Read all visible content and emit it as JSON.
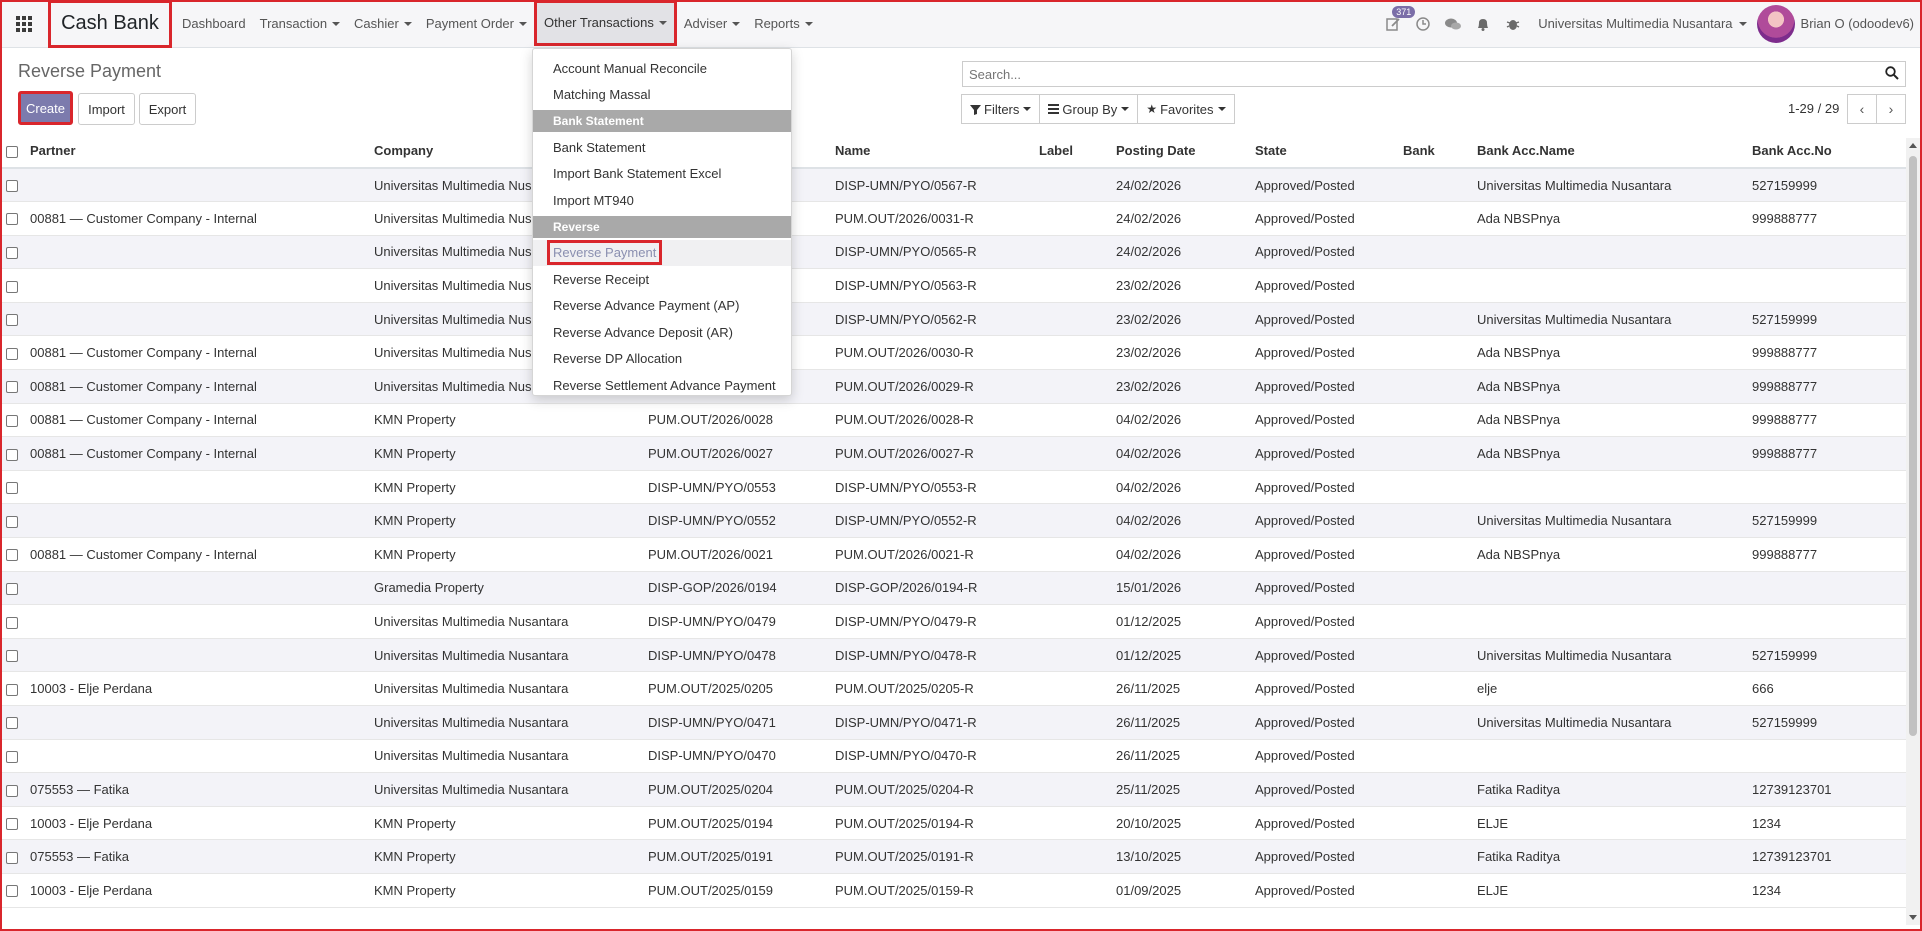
{
  "app": {
    "brand": "Cash Bank",
    "menu": [
      {
        "label": "Dashboard",
        "caret": false
      },
      {
        "label": "Transaction",
        "caret": true
      },
      {
        "label": "Cashier",
        "caret": true
      },
      {
        "label": "Payment Order",
        "caret": true
      },
      {
        "label": "Other Transactions",
        "caret": true,
        "open": true
      },
      {
        "label": "Adviser",
        "caret": true
      },
      {
        "label": "Reports",
        "caret": true
      }
    ],
    "activity_badge": "371",
    "company": "Universitas Multimedia Nusantara",
    "user": "Brian O (odoodev6)"
  },
  "control": {
    "breadcrumb": "Reverse Payment",
    "create": "Create",
    "import": "Import",
    "export": "Export",
    "search_placeholder": "Search...",
    "filters": "Filters",
    "group_by": "Group By",
    "favorites": "Favorites",
    "pager": "1-29 / 29"
  },
  "dropdown": {
    "items": [
      {
        "type": "item",
        "label": "Account Manual Reconcile"
      },
      {
        "type": "item",
        "label": "Matching Massal"
      },
      {
        "type": "header",
        "label": "Bank Statement"
      },
      {
        "type": "item",
        "label": "Bank Statement"
      },
      {
        "type": "item",
        "label": "Import Bank Statement Excel"
      },
      {
        "type": "item",
        "label": "Import MT940"
      },
      {
        "type": "header",
        "label": "Reverse"
      },
      {
        "type": "item",
        "label": "Reverse Payment",
        "active": true
      },
      {
        "type": "item",
        "label": "Reverse Receipt"
      },
      {
        "type": "item",
        "label": "Reverse Advance Payment (AP)"
      },
      {
        "type": "item",
        "label": "Reverse Advance Deposit (AR)"
      },
      {
        "type": "item",
        "label": "Reverse DP Allocation"
      },
      {
        "type": "item",
        "label": "Reverse Settlement Advance Payment"
      }
    ]
  },
  "table": {
    "columns": [
      "Partner",
      "Company",
      "",
      "Name",
      "Label",
      "Posting Date",
      "State",
      "Bank",
      "Bank Acc.Name",
      "Bank Acc.No"
    ],
    "rows": [
      [
        "",
        "Universitas Multimedia Nusantara",
        "",
        "DISP-UMN/PYO/0567-R",
        "",
        "24/02/2026",
        "Approved/Posted",
        "",
        "Universitas Multimedia Nusantara",
        "527159999"
      ],
      [
        "00881 — Customer Company - Internal",
        "Universitas Multimedia Nusantara",
        "",
        "PUM.OUT/2026/0031-R",
        "",
        "24/02/2026",
        "Approved/Posted",
        "",
        "Ada NBSPnya",
        "999888777"
      ],
      [
        "",
        "Universitas Multimedia Nusantara",
        "",
        "DISP-UMN/PYO/0565-R",
        "",
        "24/02/2026",
        "Approved/Posted",
        "",
        "",
        ""
      ],
      [
        "",
        "Universitas Multimedia Nusantara",
        "",
        "DISP-UMN/PYO/0563-R",
        "",
        "23/02/2026",
        "Approved/Posted",
        "",
        "",
        ""
      ],
      [
        "",
        "Universitas Multimedia Nusantara",
        "",
        "DISP-UMN/PYO/0562-R",
        "",
        "23/02/2026",
        "Approved/Posted",
        "",
        "Universitas Multimedia Nusantara",
        "527159999"
      ],
      [
        "00881 — Customer Company - Internal",
        "Universitas Multimedia Nusantara",
        "",
        "PUM.OUT/2026/0030-R",
        "",
        "23/02/2026",
        "Approved/Posted",
        "",
        "Ada NBSPnya",
        "999888777"
      ],
      [
        "00881 — Customer Company - Internal",
        "Universitas Multimedia Nusantara",
        "",
        "PUM.OUT/2026/0029-R",
        "",
        "23/02/2026",
        "Approved/Posted",
        "",
        "Ada NBSPnya",
        "999888777"
      ],
      [
        "00881 — Customer Company - Internal",
        "KMN Property",
        "PUM.OUT/2026/0028",
        "PUM.OUT/2026/0028-R",
        "",
        "04/02/2026",
        "Approved/Posted",
        "",
        "Ada NBSPnya",
        "999888777"
      ],
      [
        "00881 — Customer Company - Internal",
        "KMN Property",
        "PUM.OUT/2026/0027",
        "PUM.OUT/2026/0027-R",
        "",
        "04/02/2026",
        "Approved/Posted",
        "",
        "Ada NBSPnya",
        "999888777"
      ],
      [
        "",
        "KMN Property",
        "DISP-UMN/PYO/0553",
        "DISP-UMN/PYO/0553-R",
        "",
        "04/02/2026",
        "Approved/Posted",
        "",
        "",
        ""
      ],
      [
        "",
        "KMN Property",
        "DISP-UMN/PYO/0552",
        "DISP-UMN/PYO/0552-R",
        "",
        "04/02/2026",
        "Approved/Posted",
        "",
        "Universitas Multimedia Nusantara",
        "527159999"
      ],
      [
        "00881 — Customer Company - Internal",
        "KMN Property",
        "PUM.OUT/2026/0021",
        "PUM.OUT/2026/0021-R",
        "",
        "04/02/2026",
        "Approved/Posted",
        "",
        "Ada NBSPnya",
        "999888777"
      ],
      [
        "",
        "Gramedia Property",
        "DISP-GOP/2026/0194",
        "DISP-GOP/2026/0194-R",
        "",
        "15/01/2026",
        "Approved/Posted",
        "",
        "",
        ""
      ],
      [
        "",
        "Universitas Multimedia Nusantara",
        "DISP-UMN/PYO/0479",
        "DISP-UMN/PYO/0479-R",
        "",
        "01/12/2025",
        "Approved/Posted",
        "",
        "",
        ""
      ],
      [
        "",
        "Universitas Multimedia Nusantara",
        "DISP-UMN/PYO/0478",
        "DISP-UMN/PYO/0478-R",
        "",
        "01/12/2025",
        "Approved/Posted",
        "",
        "Universitas Multimedia Nusantara",
        "527159999"
      ],
      [
        "10003 - Elje Perdana",
        "Universitas Multimedia Nusantara",
        "PUM.OUT/2025/0205",
        "PUM.OUT/2025/0205-R",
        "",
        "26/11/2025",
        "Approved/Posted",
        "",
        "elje",
        "666"
      ],
      [
        "",
        "Universitas Multimedia Nusantara",
        "DISP-UMN/PYO/0471",
        "DISP-UMN/PYO/0471-R",
        "",
        "26/11/2025",
        "Approved/Posted",
        "",
        "Universitas Multimedia Nusantara",
        "527159999"
      ],
      [
        "",
        "Universitas Multimedia Nusantara",
        "DISP-UMN/PYO/0470",
        "DISP-UMN/PYO/0470-R",
        "",
        "26/11/2025",
        "Approved/Posted",
        "",
        "",
        ""
      ],
      [
        "075553 — Fatika",
        "Universitas Multimedia Nusantara",
        "PUM.OUT/2025/0204",
        "PUM.OUT/2025/0204-R",
        "",
        "25/11/2025",
        "Approved/Posted",
        "",
        "Fatika Raditya",
        "12739123701"
      ],
      [
        "10003 - Elje Perdana",
        "KMN Property",
        "PUM.OUT/2025/0194",
        "PUM.OUT/2025/0194-R",
        "",
        "20/10/2025",
        "Approved/Posted",
        "",
        "ELJE",
        "1234"
      ],
      [
        "075553 — Fatika",
        "KMN Property",
        "PUM.OUT/2025/0191",
        "PUM.OUT/2025/0191-R",
        "",
        "13/10/2025",
        "Approved/Posted",
        "",
        "Fatika Raditya",
        "12739123701"
      ],
      [
        "10003 - Elje Perdana",
        "KMN Property",
        "PUM.OUT/2025/0159",
        "PUM.OUT/2025/0159-R",
        "",
        "01/09/2025",
        "Approved/Posted",
        "",
        "ELJE",
        "1234"
      ]
    ]
  },
  "colors": {
    "accent": "#7c7bad",
    "highlight_box": "#d9262c",
    "row_alt": "#f3f3f8",
    "dropdown_header": "#a9a9a9"
  }
}
